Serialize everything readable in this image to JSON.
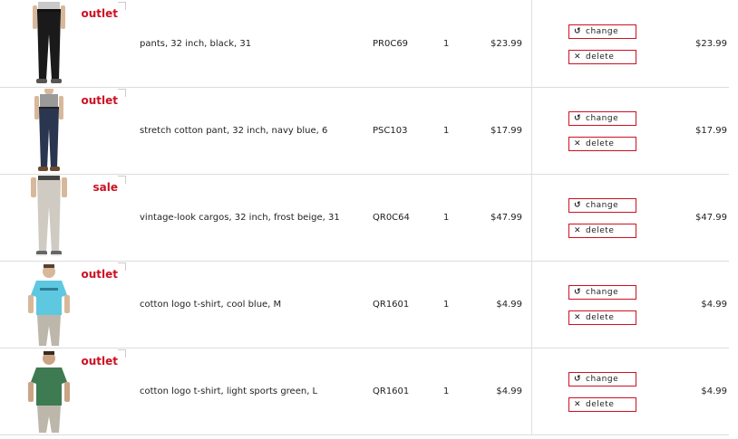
{
  "colors": {
    "accent": "#cc1122",
    "divider": "#dcdcdc",
    "text": "#222222"
  },
  "icons": {
    "change": "undo-arrow-icon",
    "delete": "x-icon"
  },
  "items": [
    {
      "badge": "outlet",
      "product_image": "black-pants-photo",
      "description": "pants, 32 inch, black, 31",
      "code": "PR0C69",
      "quantity": "1",
      "price": "$23.99",
      "change_label": "change",
      "delete_label": "delete",
      "total": "$23.99"
    },
    {
      "badge": "outlet",
      "product_image": "navy-pants-photo",
      "description": "stretch cotton pant, 32 inch, navy blue, 6",
      "code": "PSC103",
      "quantity": "1",
      "price": "$17.99",
      "change_label": "change",
      "delete_label": "delete",
      "total": "$17.99"
    },
    {
      "badge": "sale",
      "product_image": "beige-cargos-photo",
      "description": "vintage-look cargos, 32 inch, frost beige, 31",
      "code": "QR0C64",
      "quantity": "1",
      "price": "$47.99",
      "change_label": "change",
      "delete_label": "delete",
      "total": "$47.99"
    },
    {
      "badge": "outlet",
      "product_image": "blue-tshirt-photo",
      "description": "cotton logo t-shirt, cool blue, M",
      "code": "QR1601",
      "quantity": "1",
      "price": "$4.99",
      "change_label": "change",
      "delete_label": "delete",
      "total": "$4.99"
    },
    {
      "badge": "outlet",
      "product_image": "green-tshirt-photo",
      "description": "cotton logo t-shirt, light sports green, L",
      "code": "QR1601",
      "quantity": "1",
      "price": "$4.99",
      "change_label": "change",
      "delete_label": "delete",
      "total": "$4.99"
    }
  ]
}
